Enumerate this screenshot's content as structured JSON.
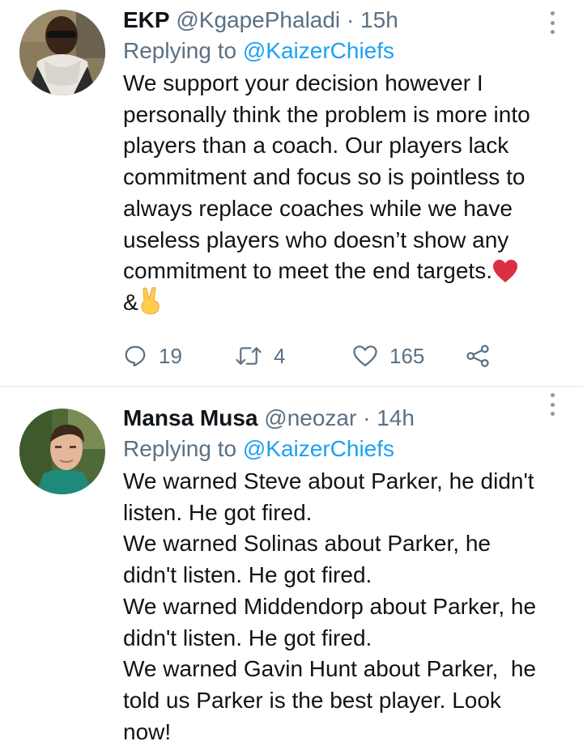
{
  "tweets": [
    {
      "name": "EKP",
      "handle": "@KgapePhaladi",
      "separator": "·",
      "time": "15h",
      "replying_prefix": "Replying to ",
      "replying_to": "@KaizerChiefs",
      "lines": [
        "We support your decision however I",
        "personally think the problem is more into",
        "players than a coach. Our players lack",
        "commitment and focus so is pointless to",
        "always replace coaches while we have",
        "useless players who doesn’t show any",
        "commitment to meet the end targets."
      ],
      "last_line": "&",
      "emojis": [
        "red-heart",
        "victory-hand"
      ],
      "replies": "19",
      "retweets": "4",
      "likes": "165",
      "avatar_icon": "profile-photo-man-sunglasses-scarf"
    },
    {
      "name": "Mansa Musa",
      "handle": "@neozar",
      "separator": "·",
      "time": "14h",
      "replying_prefix": "Replying to ",
      "replying_to": "@KaizerChiefs",
      "lines": [
        "We warned Steve about Parker, he didn't",
        "listen. He got fired.",
        "We warned Solinas about Parker, he",
        "didn't listen. He got fired.",
        "We warned Middendorp about Parker, he",
        "didn't listen. He got fired.",
        "We warned Gavin Hunt about Parker,  he",
        "told us Parker is the best player. Look",
        "now!"
      ],
      "avatar_icon": "profile-photo-young-man-outdoors"
    }
  ],
  "colors": {
    "text": "#0f1419",
    "secondary": "#5b7083",
    "link": "#1da1f2",
    "heart": "#e0245e",
    "divider": "#e1e5e8"
  }
}
